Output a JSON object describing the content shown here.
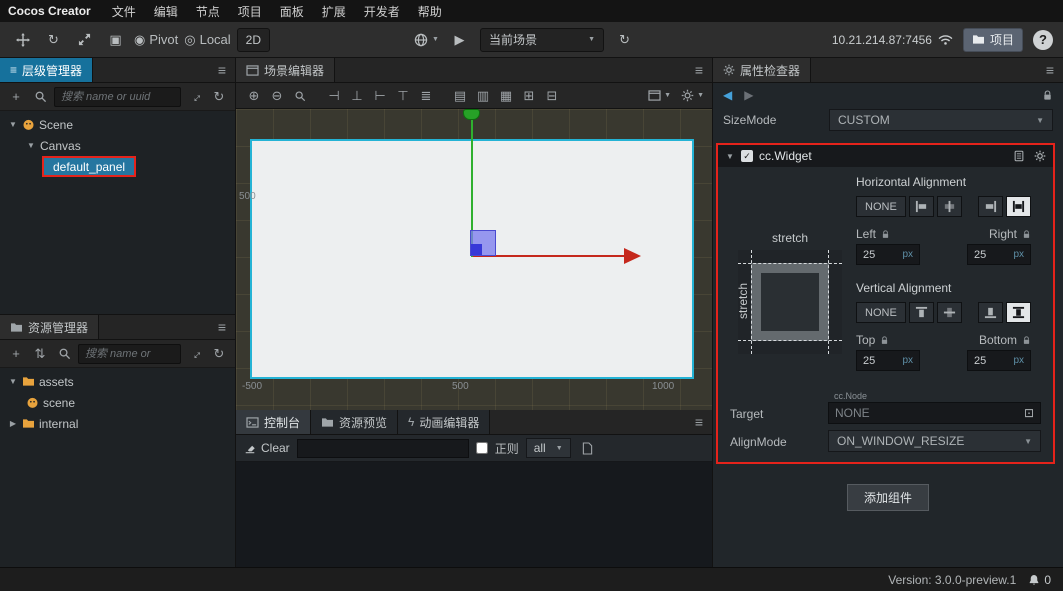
{
  "menubar": {
    "app_title": "Cocos Creator",
    "items": [
      "文件",
      "编辑",
      "节点",
      "项目",
      "面板",
      "扩展",
      "开发者",
      "帮助"
    ]
  },
  "toolbar": {
    "pivot_label": "Pivot",
    "local_label": "Local",
    "mode_2d": "2D",
    "scene_dropdown": "当前场景",
    "address": "10.21.214.87:7456",
    "project_button": "项目",
    "help": "?"
  },
  "hierarchy": {
    "title": "层级管理器",
    "search_placeholder": "搜索 name or uuid",
    "tree": [
      {
        "label": "Scene"
      },
      {
        "label": "Canvas"
      },
      {
        "label": "default_panel"
      }
    ]
  },
  "assets_panel": {
    "title": "资源管理器",
    "search_placeholder": "搜索 name or",
    "tree": [
      {
        "label": "assets"
      },
      {
        "label": "scene"
      },
      {
        "label": "internal"
      }
    ]
  },
  "scene_editor": {
    "title": "场景编辑器",
    "toolbar_glyphs": [
      "⊣",
      "⊥",
      "⊢",
      "⊤",
      "≣",
      "▤",
      "▥",
      "▦",
      "⊞",
      "⊟"
    ],
    "ruler": {
      "left": "500",
      "bottom_1": "-500",
      "bottom_2": "500",
      "bottom_3": "1000"
    }
  },
  "console": {
    "tabs": [
      {
        "label": "控制台"
      },
      {
        "label": "资源预览"
      },
      {
        "label": "动画编辑器"
      }
    ],
    "clear_label": "Clear",
    "regex_label": "正则",
    "filter_value": "all"
  },
  "inspector": {
    "title": "属性检查器",
    "sizemode_label": "SizeMode",
    "sizemode_value": "CUSTOM",
    "widget": {
      "name": "cc.Widget",
      "horizontal_label": "Horizontal Alignment",
      "vertical_label": "Vertical Alignment",
      "none_h": "NONE",
      "none_v": "NONE",
      "stretch_top": "stretch",
      "stretch_left": "stretch",
      "left_label": "Left",
      "right_label": "Right",
      "top_label": "Top",
      "bottom_label": "Bottom",
      "left_value": "25",
      "right_value": "25",
      "top_value": "25",
      "bottom_value": "25",
      "unit": "px",
      "target_label": "Target",
      "target_type": "cc.Node",
      "target_value": "NONE",
      "alignmode_label": "AlignMode",
      "alignmode_value": "ON_WINDOW_RESIZE"
    },
    "add_component": "添加组件"
  },
  "statusbar": {
    "version": "Version: 3.0.0-preview.1",
    "notification_count": "0"
  },
  "icons": {
    "caret_down": "▼",
    "caret_right": "▶",
    "menu": "≡",
    "plus": "+",
    "refresh": "↻",
    "rotate": "↻",
    "play": "▶",
    "zoom_in": "⊕",
    "zoom_out": "⊖",
    "rect_tool": "▣",
    "pivot": "◉",
    "local": "◎",
    "check": "✓",
    "expand": "↔",
    "sort": "⇅",
    "picker": "⊡",
    "dropdown": "▼",
    "back": "◀",
    "forward": "▶",
    "lightning": "ϟ"
  },
  "colors": {
    "accent_teal": "#16719c",
    "selection_red": "#e5231b",
    "cocos_orange": "#e8a33d",
    "axis_green": "#2fb02f",
    "axis_red": "#c5281c",
    "canvas_border": "#24b3d5"
  }
}
